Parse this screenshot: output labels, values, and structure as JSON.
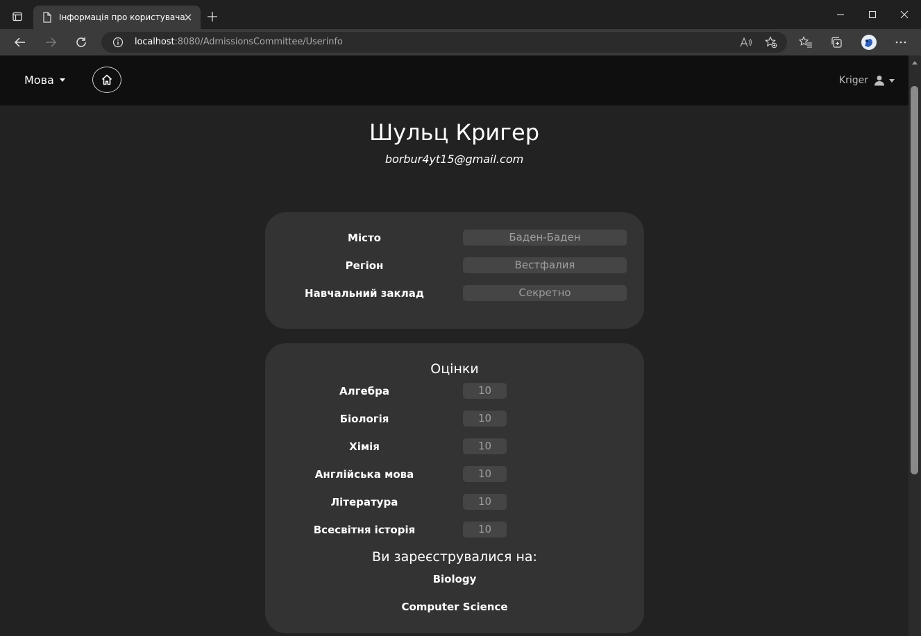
{
  "browser": {
    "tab_title": "Інформація про користувача",
    "url_host": "localhost",
    "url_path": ":8080/AdmissionsCommittee/Userinfo"
  },
  "navbar": {
    "language_label": "Мова",
    "username": "Kriger"
  },
  "profile": {
    "full_name": "Шульц Кригер",
    "email": "borbur4yt15@gmail.com"
  },
  "info": [
    {
      "label": "Місто",
      "value": "Баден-Баден"
    },
    {
      "label": "Регіон",
      "value": "Вестфалия"
    },
    {
      "label": "Навчальний заклад",
      "value": "Секретно"
    }
  ],
  "grades": {
    "title": "Оцінки",
    "items": [
      {
        "subject": "Алгебра",
        "score": "10"
      },
      {
        "subject": "Біологія",
        "score": "10"
      },
      {
        "subject": "Хімія",
        "score": "10"
      },
      {
        "subject": "Англійська мова",
        "score": "10"
      },
      {
        "subject": "Література",
        "score": "10"
      },
      {
        "subject": "Всесвітня історія",
        "score": "10"
      }
    ]
  },
  "registrations": {
    "title": "Ви зареєструвалися на:",
    "faculties": [
      "Biology",
      "Computer Science"
    ]
  },
  "colors": {
    "navbar_bg": "#0f0f0f",
    "page_bg": "#222222",
    "card_bg": "#333333",
    "field_bg": "#454545"
  }
}
